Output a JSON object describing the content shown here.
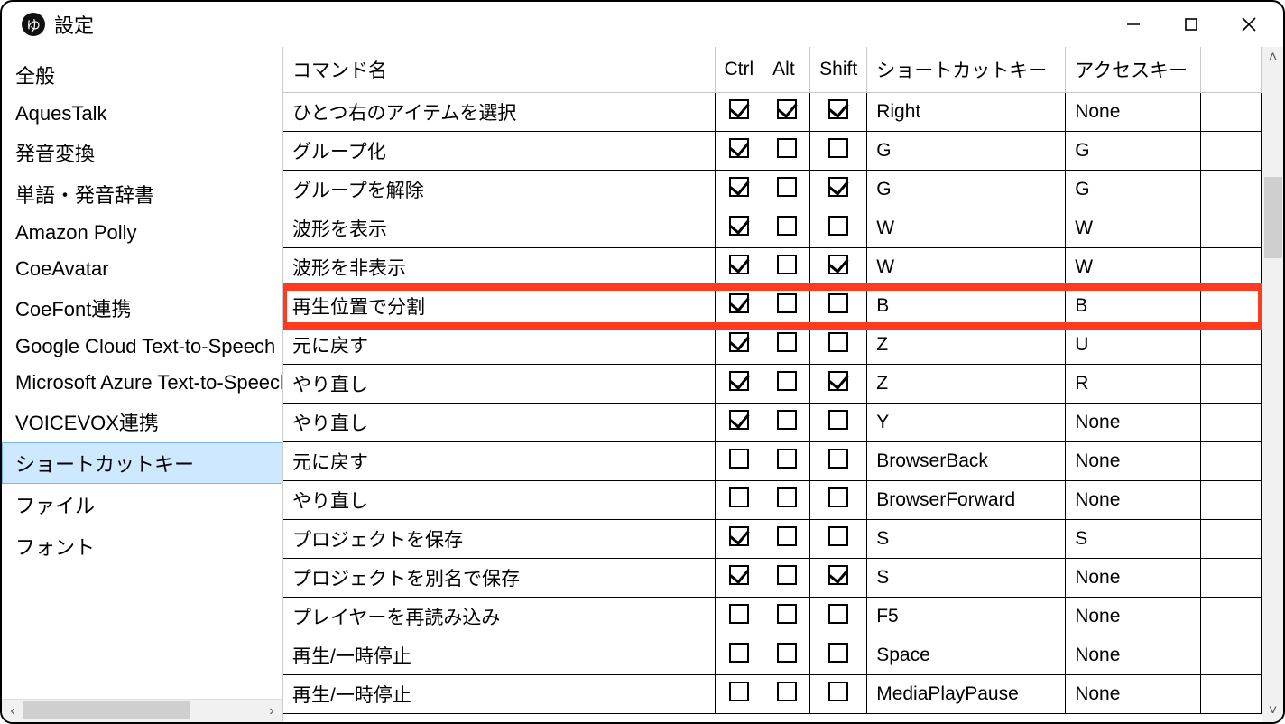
{
  "window": {
    "title": "設定"
  },
  "sidebar": {
    "items": [
      {
        "label": "全般"
      },
      {
        "label": "AquesTalk"
      },
      {
        "label": "発音変換"
      },
      {
        "label": "単語・発音辞書"
      },
      {
        "label": "Amazon Polly"
      },
      {
        "label": "CoeAvatar"
      },
      {
        "label": "CoeFont連携"
      },
      {
        "label": "Google Cloud Text-to-Speech"
      },
      {
        "label": "Microsoft Azure Text-to-Speech"
      },
      {
        "label": "VOICEVOX連携"
      },
      {
        "label": "ショートカットキー"
      },
      {
        "label": "ファイル"
      },
      {
        "label": "フォント"
      }
    ],
    "selected_index": 10
  },
  "table": {
    "headers": {
      "command": "コマンド名",
      "ctrl": "Ctrl",
      "alt": "Alt",
      "shift": "Shift",
      "shortcut": "ショートカットキー",
      "access": "アクセスキー"
    },
    "highlighted_index": 5,
    "rows": [
      {
        "command": "ひとつ右のアイテムを選択",
        "ctrl": true,
        "alt": true,
        "shift": true,
        "shortcut": "Right",
        "access": "None"
      },
      {
        "command": "グループ化",
        "ctrl": true,
        "alt": false,
        "shift": false,
        "shortcut": "G",
        "access": "G"
      },
      {
        "command": "グループを解除",
        "ctrl": true,
        "alt": false,
        "shift": true,
        "shortcut": "G",
        "access": "G"
      },
      {
        "command": "波形を表示",
        "ctrl": true,
        "alt": false,
        "shift": false,
        "shortcut": "W",
        "access": "W"
      },
      {
        "command": "波形を非表示",
        "ctrl": true,
        "alt": false,
        "shift": true,
        "shortcut": "W",
        "access": "W"
      },
      {
        "command": "再生位置で分割",
        "ctrl": true,
        "alt": false,
        "shift": false,
        "shortcut": "B",
        "access": "B"
      },
      {
        "command": "元に戻す",
        "ctrl": true,
        "alt": false,
        "shift": false,
        "shortcut": "Z",
        "access": "U"
      },
      {
        "command": "やり直し",
        "ctrl": true,
        "alt": false,
        "shift": true,
        "shortcut": "Z",
        "access": "R"
      },
      {
        "command": "やり直し",
        "ctrl": true,
        "alt": false,
        "shift": false,
        "shortcut": "Y",
        "access": "None"
      },
      {
        "command": "元に戻す",
        "ctrl": false,
        "alt": false,
        "shift": false,
        "shortcut": "BrowserBack",
        "access": "None"
      },
      {
        "command": "やり直し",
        "ctrl": false,
        "alt": false,
        "shift": false,
        "shortcut": "BrowserForward",
        "access": "None"
      },
      {
        "command": "プロジェクトを保存",
        "ctrl": true,
        "alt": false,
        "shift": false,
        "shortcut": "S",
        "access": "S"
      },
      {
        "command": "プロジェクトを別名で保存",
        "ctrl": true,
        "alt": false,
        "shift": true,
        "shortcut": "S",
        "access": "None"
      },
      {
        "command": "プレイヤーを再読み込み",
        "ctrl": false,
        "alt": false,
        "shift": false,
        "shortcut": "F5",
        "access": "None"
      },
      {
        "command": "再生/一時停止",
        "ctrl": false,
        "alt": false,
        "shift": false,
        "shortcut": "Space",
        "access": "None"
      },
      {
        "command": "再生/一時停止",
        "ctrl": false,
        "alt": false,
        "shift": false,
        "shortcut": "MediaPlayPause",
        "access": "None"
      }
    ]
  }
}
